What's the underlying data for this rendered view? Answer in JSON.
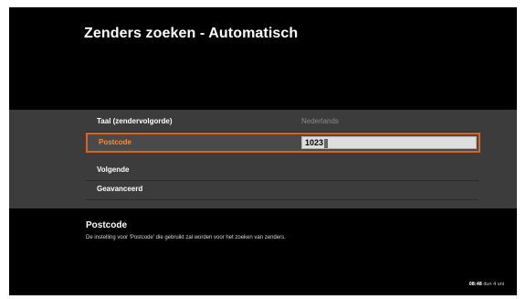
{
  "header": {
    "title": "Zenders zoeken - Automatisch"
  },
  "settings": {
    "rows": [
      {
        "label": "Taal (zendervolgorde)",
        "value": "Nederlands"
      },
      {
        "label": "Postcode",
        "value": "1023"
      },
      {
        "label": "Volgende",
        "value": ""
      },
      {
        "label": "Geavanceerd",
        "value": ""
      }
    ]
  },
  "info": {
    "title": "Postcode",
    "description": "De instelling voor 'Postcode' die gebruikt zal worden voor het zoeken van zenders."
  },
  "status": {
    "time": "08:48",
    "suffix": "dun 4 uni"
  },
  "colors": {
    "accent": "#d9651a",
    "background": "#000000",
    "panel": "#3c3c3c"
  }
}
